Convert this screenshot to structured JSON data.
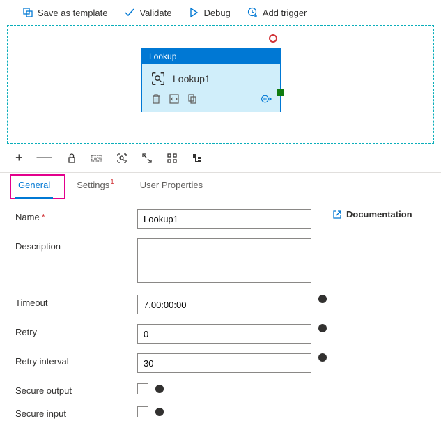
{
  "toolbar": {
    "save_template": "Save as template",
    "validate": "Validate",
    "debug": "Debug",
    "add_trigger": "Add trigger"
  },
  "activity": {
    "type_label": "Lookup",
    "name": "Lookup1"
  },
  "tabs": {
    "general": "General",
    "settings": "Settings",
    "settings_badge": "1",
    "user_properties": "User Properties"
  },
  "form": {
    "name_label": "Name",
    "name_value": "Lookup1",
    "description_label": "Description",
    "description_value": "",
    "timeout_label": "Timeout",
    "timeout_value": "7.00:00:00",
    "retry_label": "Retry",
    "retry_value": "0",
    "retry_interval_label": "Retry interval",
    "retry_interval_value": "30",
    "secure_output_label": "Secure output",
    "secure_input_label": "Secure input"
  },
  "links": {
    "documentation": "Documentation"
  }
}
